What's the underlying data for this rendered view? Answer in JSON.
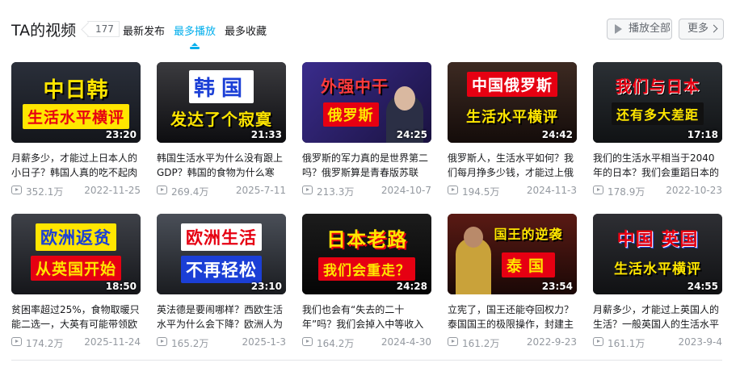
{
  "header": {
    "title": "TA的视频",
    "count": "177",
    "tabs": [
      {
        "label": "最新发布",
        "active": false
      },
      {
        "label": "最多播放",
        "active": true
      },
      {
        "label": "最多收藏",
        "active": false
      }
    ],
    "play_all_label": "播放全部",
    "more_label": "更多"
  },
  "colors": {
    "accent": "#00aeec",
    "text": "#18191c",
    "secondary": "#9499a0",
    "thumb_yellow": "#ffe600",
    "thumb_red": "#e60012",
    "thumb_blue": "#1b3fd6"
  },
  "videos": [
    {
      "thumb_lines": [
        "中日韩",
        "生活水平横评"
      ],
      "duration": "23:20",
      "desc": "月薪多少，才能过上日本人的小日子？韩国人真的吃不起肉",
      "views": "352.1万",
      "date": "2022-11-25"
    },
    {
      "thumb_lines": [
        "韩国",
        "发达了个寂寞"
      ],
      "duration": "21:33",
      "desc": "韩国生活水平为什么没有跟上GDP？韩国的食物为什么寒",
      "views": "269.4万",
      "date": "2025-7-11"
    },
    {
      "thumb_lines": [
        "外强中干",
        "俄罗斯"
      ],
      "duration": "24:25",
      "desc": "俄罗斯的军力真的是世界第二吗？俄罗斯算是青春版苏联",
      "views": "213.3万",
      "date": "2024-10-7"
    },
    {
      "thumb_lines": [
        "中国俄罗斯",
        "生活水平横评"
      ],
      "duration": "24:42",
      "desc": "俄罗斯人，生活水平如何？我们每月挣多少钱，才能过上俄",
      "views": "194.5万",
      "date": "2024-11-3"
    },
    {
      "thumb_lines": [
        "我们与日本",
        "还有多大差距"
      ],
      "duration": "17:18",
      "desc": "我们的生活水平相当于2040年的日本？我们会重蹈日本的",
      "views": "178.9万",
      "date": "2022-10-23"
    },
    {
      "thumb_lines": [
        "欧洲返贫",
        "从英国开始"
      ],
      "duration": "18:50",
      "desc": "贫困率超过25%，食物取暖只能二选一，大英有可能带领欧",
      "views": "174.2万",
      "date": "2025-11-24"
    },
    {
      "thumb_lines": [
        "欧洲生活",
        "不再轻松"
      ],
      "duration": "23:10",
      "desc": "英法德是要闹哪样？西欧生活水平为什么会下降？欧洲人为",
      "views": "165.2万",
      "date": "2025-1-3"
    },
    {
      "thumb_lines": [
        "日本老路",
        "我们会重走？"
      ],
      "duration": "24:28",
      "desc": "我们也会有“失去的二十年”吗？我们会掉入中等收入陷阱",
      "views": "164.2万",
      "date": "2024-4-30"
    },
    {
      "thumb_lines": [
        "国王的逆袭",
        "泰国"
      ],
      "duration": "23:54",
      "desc": "立宪了，国王还能夺回权力？泰国国王的极限操作，封建主",
      "views": "161.2万",
      "date": "2022-9-23"
    },
    {
      "thumb_lines": [
        "中国 英国",
        "生活水平横评"
      ],
      "duration": "24:55",
      "desc": "月薪多少，才能过上英国人的生活？一般英国人的生活水平",
      "views": "161.1万",
      "date": "2023-9-4"
    }
  ]
}
